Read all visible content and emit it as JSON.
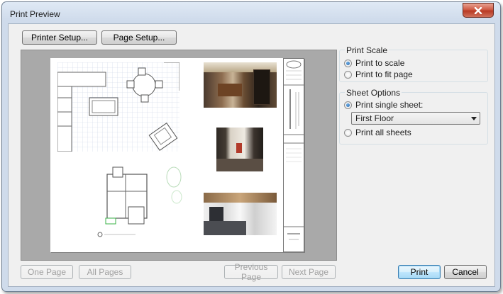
{
  "window": {
    "title": "Print Preview"
  },
  "top_buttons": {
    "printer_setup": "Printer Setup...",
    "page_setup": "Page Setup..."
  },
  "nav_buttons": {
    "one_page": "One Page",
    "all_pages": "All Pages",
    "previous_page": "Previous Page",
    "next_page": "Next Page"
  },
  "actions": {
    "print": "Print",
    "cancel": "Cancel"
  },
  "print_scale": {
    "label": "Print Scale",
    "options": [
      {
        "label": "Print to scale",
        "selected": true
      },
      {
        "label": "Print to fit page",
        "selected": false
      }
    ]
  },
  "sheet_options": {
    "label": "Sheet Options",
    "single_sheet": {
      "label": "Print single sheet:",
      "selected": true
    },
    "sheet_select": {
      "value": "First Floor"
    },
    "all_sheets": {
      "label": "Print all sheets",
      "selected": false
    }
  },
  "colors": {
    "accent": "#3c7fb1",
    "preview_bg": "#a9a9a9",
    "close_red": "#c94a33"
  }
}
